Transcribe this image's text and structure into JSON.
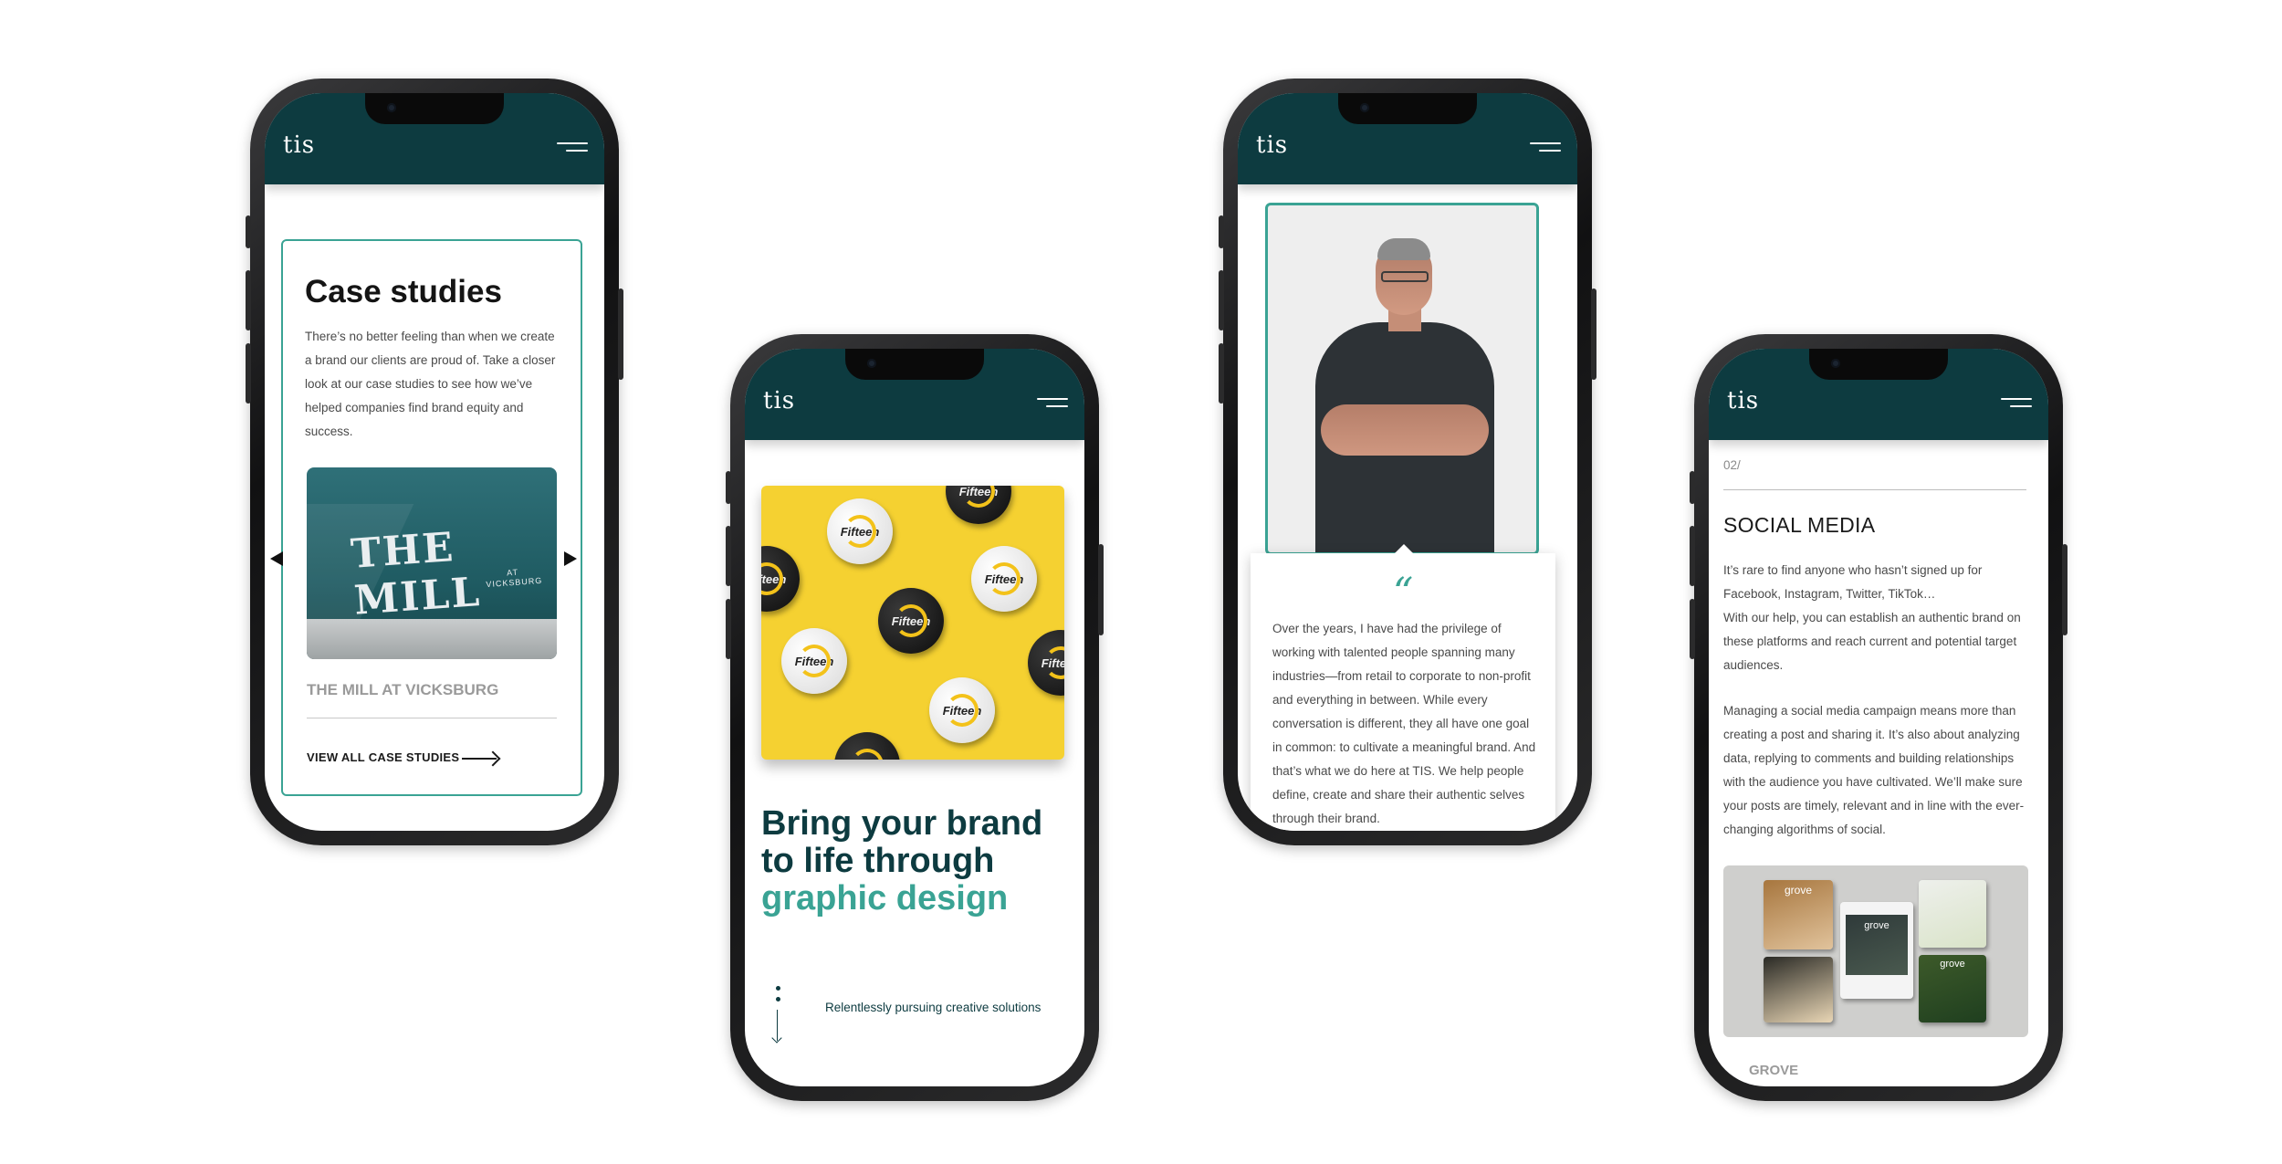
{
  "brand": {
    "logo_text": "tis",
    "primary": "#0d3b40",
    "accent": "#3aa394"
  },
  "icons": {
    "menu": "hamburger-menu-icon",
    "prev": "chevron-left-icon",
    "next": "chevron-right-icon",
    "arrow": "long-arrow-right-icon",
    "scroll": "scroll-down-icon",
    "quote": "quote-icon"
  },
  "phone1": {
    "title": "Case studies",
    "intro": "There’s no better feeling than when we create a brand our clients are proud of. Take a closer look at our case studies to see how we’ve helped companies find brand equity and success.",
    "image_logo": "THE MILL",
    "image_logo_sub": "AT VICKSBURG",
    "caption": "THE MILL AT VICKSBURG",
    "view_all": "VIEW ALL CASE STUDIES"
  },
  "phone2": {
    "badge_text": "Fifteen",
    "hero_line1": "Bring your brand",
    "hero_line2": "to life through",
    "hero_accent": "graphic design",
    "tagline": "Relentlessly pursuing creative solutions"
  },
  "phone3": {
    "quote_mark": "“",
    "quote": "Over the years, I have had the privilege of working with talented people spanning many industries—from retail to corporate to non-profit and everything in between. While every conversation is different, they all have one goal in common: to cultivate a meaningful brand. And that’s what we do here at TIS. We help people define, create and share their authentic selves through their brand."
  },
  "phone4": {
    "section_number": "02/",
    "section_title": "SOCIAL MEDIA",
    "paragraph1_line1": "It’s rare to find anyone who hasn’t signed up for Facebook, Instagram, Twitter, TikTok…",
    "paragraph1_line2": "With our help, you can establish an authentic brand on these platforms and reach current and potential target audiences.",
    "paragraph2": "Managing a social media campaign means more than creating a post and sharing it. It’s also about analyzing data, replying to comments and building relationships with the audience you have cultivated. We’ll make sure your posts are timely, relevant and in line with the ever-changing algorithms of social.",
    "tile_text": "grove",
    "caption": "GROVE"
  }
}
